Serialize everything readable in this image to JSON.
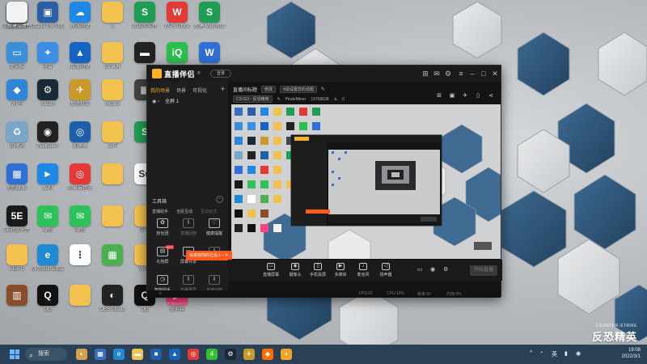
{
  "desktop": {
    "icons": [
      {
        "label": "人工智能软件",
        "glyph": "◨",
        "color": "#3a6fbf",
        "icon": "folder-icon"
      },
      {
        "label": "Oracle VM VirtualBox",
        "glyph": "▣",
        "color": "#2a5fa8",
        "icon": "virtualbox-icon"
      },
      {
        "label": "腾讯网盘",
        "glyph": "☁",
        "color": "#1e88e5",
        "icon": "cloud-drive-icon"
      },
      {
        "label": "1",
        "glyph": "",
        "color": "#f2c14e",
        "icon": "folder-icon"
      },
      {
        "label": "2022年软件",
        "glyph": "S",
        "color": "#1f9d55",
        "icon": "spreadsheet-icon"
      },
      {
        "label": "WPS Office",
        "glyph": "W",
        "color": "#e53935",
        "icon": "wps-icon"
      },
      {
        "label": "新建 Microsoft",
        "glyph": "S",
        "color": "#1f9d55",
        "icon": "spreadsheet-icon"
      },
      {
        "label": "此电脑",
        "glyph": "▭",
        "color": "#3b8ed8",
        "icon": "computer-icon"
      },
      {
        "label": "迅雷",
        "glyph": "✦",
        "color": "#3a8ee6",
        "icon": "thunder-icon"
      },
      {
        "label": "百度网盘",
        "glyph": "▲",
        "color": "#1565c0",
        "icon": "baidu-drive-icon"
      },
      {
        "label": "EV录屏",
        "glyph": "",
        "color": "#f2c14e",
        "icon": "folder-icon"
      },
      {
        "label": "",
        "glyph": "▬",
        "color": "#222222",
        "icon": "app-icon"
      },
      {
        "label": "iQIYI",
        "glyph": "iQ",
        "color": "#2cbf4d",
        "icon": "iqiyi-icon"
      },
      {
        "label": "WPS",
        "glyph": "W",
        "color": "#2f6fd6",
        "icon": "wps-icon"
      },
      {
        "label": "Wi-Fi",
        "glyph": "◆",
        "color": "#2f86d6",
        "icon": "wifi-icon"
      },
      {
        "label": "Steam",
        "glyph": "⚙",
        "color": "#1b2838",
        "icon": "steam-icon"
      },
      {
        "label": "反恐精英",
        "glyph": "✈",
        "color": "#c89a2a",
        "icon": "game-icon"
      },
      {
        "label": "mobile",
        "glyph": "",
        "color": "#f2c14e",
        "icon": "folder-icon"
      },
      {
        "label": "",
        "glyph": "▦",
        "color": "#444444",
        "icon": "app-icon"
      },
      {
        "label": "回收站",
        "glyph": "♻",
        "color": "#7aa6c9",
        "icon": "recycle-bin-icon"
      },
      {
        "label": "Wallpaper",
        "glyph": "◉",
        "color": "#222222",
        "icon": "wallpaper-icon"
      },
      {
        "label": "加速器",
        "glyph": "◎",
        "color": "#1d5fa8",
        "icon": "accelerator-icon"
      },
      {
        "label": "工作",
        "glyph": "",
        "color": "#f2c14e",
        "icon": "folder-icon"
      },
      {
        "label": "",
        "glyph": "S",
        "color": "#1f9d55",
        "icon": "spreadsheet-icon"
      },
      {
        "label": "控制面板",
        "glyph": "▩",
        "color": "#2f6fd6",
        "icon": "control-panel-icon"
      },
      {
        "label": "酷狗",
        "glyph": "►",
        "color": "#1e88e5",
        "icon": "player-icon"
      },
      {
        "label": "网易云音乐",
        "glyph": "◎",
        "color": "#e53935",
        "icon": "netease-music-icon"
      },
      {
        "label": "",
        "glyph": "",
        "color": "#f2c14e",
        "icon": "folder-icon"
      },
      {
        "label": "",
        "glyph": "Su",
        "color": "#ffffff",
        "icon": "app-icon"
      },
      {
        "label": "5E对战平台",
        "glyph": "5E",
        "color": "#1a1a1a",
        "icon": "5e-icon"
      },
      {
        "label": "微信",
        "glyph": "✉",
        "color": "#2ec25a",
        "icon": "wechat-icon"
      },
      {
        "label": "微信",
        "glyph": "✉",
        "color": "#2ec25a",
        "icon": "wechat-icon"
      },
      {
        "label": "",
        "glyph": "",
        "color": "#f2c14e",
        "icon": "folder-icon"
      },
      {
        "label": "学习",
        "glyph": "",
        "color": "#f2c14e",
        "icon": "folder-icon"
      },
      {
        "label": "BEA-C",
        "glyph": "",
        "color": "#f2c14e",
        "icon": "folder-icon"
      },
      {
        "label": "Microsoft Edge",
        "glyph": "e",
        "color": "#1f8ad2",
        "icon": "edge-icon"
      },
      {
        "label": "",
        "glyph": "⋮",
        "color": "#ffffff",
        "icon": "app-icon"
      },
      {
        "label": "",
        "glyph": "▦",
        "color": "#4caf50",
        "icon": "minecraft-icon"
      },
      {
        "label": "Word",
        "glyph": "",
        "color": "#f2c14e",
        "icon": "folder-icon"
      },
      {
        "label": "",
        "glyph": "▥",
        "color": "#8a4d2a",
        "icon": "archive-icon"
      },
      {
        "label": "QQ",
        "glyph": "Q",
        "color": "#111111",
        "icon": "qq-icon"
      },
      {
        "label": "",
        "glyph": "",
        "color": "#f2c14e",
        "icon": "folder-icon"
      },
      {
        "label": "OBS Studio",
        "glyph": "◐",
        "color": "#222222",
        "icon": "obs-icon"
      },
      {
        "label": "QQ",
        "glyph": "Q",
        "color": "#111111",
        "icon": "qq-icon"
      },
      {
        "label": "快剪辑",
        "glyph": "▶",
        "color": "#ff4081",
        "icon": "video-editor-icon"
      },
      {
        "label": "2022年软件",
        "glyph": "",
        "color": "#f2f2f2",
        "icon": "document-icon"
      },
      {
        "label": "",
        "glyph": "▥",
        "color": "#8a4d2a",
        "icon": "archive-icon"
      },
      {
        "label": "新建文本",
        "glyph": "",
        "color": "#f2f2f2",
        "icon": "document-icon"
      }
    ]
  },
  "app": {
    "logo_name": "直播伴侣",
    "logo_ver": "®",
    "login_label": "登录",
    "scene_tabs": [
      "我的场景",
      "场景",
      "可视化"
    ],
    "scene_add": "+",
    "scene_item": "全屏 1",
    "live_title": "直播间标题",
    "live_title_chip": "修改",
    "live_tag": "#请设置您的话题",
    "game_chip": "CS:GO - 反恐精英",
    "streamer": "PirateMiner",
    "streamer_id": "19768638",
    "viewers": "0",
    "toolbox": {
      "title": "工具箱",
      "tabs": [
        "直播助手",
        "全民互动",
        "互动玩法"
      ],
      "tools": [
        {
          "label": "粉丝团",
          "glyph": "✿",
          "dim": false
        },
        {
          "label": "直播回放",
          "glyph": "⬇",
          "dim": true
        },
        {
          "label": "健康提醒",
          "glyph": "♡",
          "dim": false
        },
        {
          "label": "礼物屏",
          "glyph": "▤",
          "dim": false,
          "hot": "HOT"
        },
        {
          "label": "屏幕共享",
          "glyph": "▭",
          "dim": false
        },
        {
          "label": "",
          "glyph": "⬇",
          "dim": true
        },
        {
          "label": "智能助手",
          "glyph": "◷",
          "dim": false
        },
        {
          "label": "直播录屏",
          "glyph": "⬇",
          "dim": true
        },
        {
          "label": "其他功能",
          "glyph": "⬇",
          "dim": true
        }
      ]
    },
    "footer_note": "上场直播60秒后观看",
    "toast": "快来用你的社会人~",
    "bottom_buttons": [
      {
        "label": "直播屏幕",
        "glyph": "▭"
      },
      {
        "label": "摄像头",
        "glyph": "◉"
      },
      {
        "label": "手机投屏",
        "glyph": "▯"
      },
      {
        "label": "多媒体",
        "glyph": "▶"
      },
      {
        "label": "麦克风",
        "glyph": "♪"
      },
      {
        "label": "扬声器",
        "glyph": "◁"
      }
    ],
    "start_live": "开始直播",
    "status_bar": [
      "FPS:60",
      "CPU:19%",
      "帧率:60",
      "内存:0%"
    ]
  },
  "taskbar": {
    "search_label": "搜索",
    "apps": [
      {
        "glyph": "◐",
        "color": "#d4a24c",
        "icon": "widgets-icon"
      },
      {
        "glyph": "▦",
        "color": "#3a6fbf",
        "icon": "task-view-icon"
      },
      {
        "glyph": "e",
        "color": "#1f8ad2",
        "icon": "edge-icon"
      },
      {
        "glyph": "▬",
        "color": "#f2c14e",
        "icon": "file-explorer-icon"
      },
      {
        "glyph": "■",
        "color": "#1e5faf",
        "icon": "store-icon"
      },
      {
        "glyph": "▲",
        "color": "#1565c0",
        "icon": "baidu-drive-icon"
      },
      {
        "glyph": "◎",
        "color": "#e53935",
        "icon": "netease-music-icon"
      },
      {
        "glyph": "4",
        "color": "#30c030",
        "icon": "game-icon"
      },
      {
        "glyph": "⚙",
        "color": "#1b2838",
        "icon": "steam-icon"
      },
      {
        "glyph": "✈",
        "color": "#c89a2a",
        "icon": "game-icon"
      },
      {
        "glyph": "◆",
        "color": "#ff6d00",
        "icon": "app-icon"
      },
      {
        "glyph": "◗",
        "color": "#f0a526",
        "icon": "live-companion-icon"
      }
    ],
    "tray": [
      "^",
      "◔",
      "英",
      "▮",
      "◉"
    ],
    "time": "19:08",
    "date": "2022/3/1"
  },
  "watermark": {
    "en": "COUNTER-STRIKE",
    "cn": "反恐精英"
  }
}
